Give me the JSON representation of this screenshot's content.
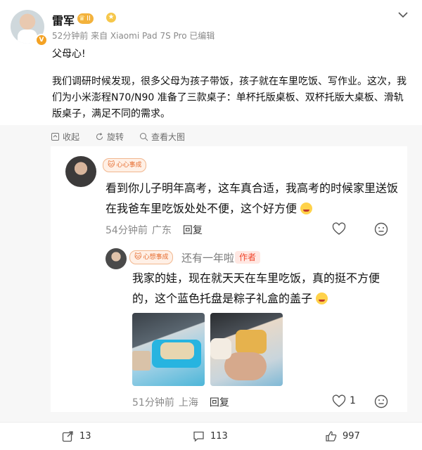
{
  "post": {
    "author": "雷军",
    "level": "II",
    "verify_mark": "V",
    "meta": "52分钟前 来自 Xiaomi Pad 7S Pro 已编辑",
    "text_line1": "父母心!",
    "text_para": "我们调研时候发现，很多父母为孩子带饭，孩子就在车里吃饭、写作业。这次，我们为小米澎程N70/N90 准备了三款桌子：单杯托版桌板、双杯托版大桌板、滑轨版桌子，满足不同的需求。"
  },
  "actions": {
    "collect": "收起",
    "rotate": "旋转",
    "view_large": "查看大图"
  },
  "comment": {
    "fan_tag": "心心事成",
    "text": "看到你儿子明年高考，这车真合适，我高考的时候家里送饭在我爸车里吃饭处处不便，这个好方便",
    "time": "54分钟前",
    "location": "广东",
    "reply_label": "回复"
  },
  "reply": {
    "fan_tag": "心想事成",
    "name": "还有一年啦",
    "author_tag": "作者",
    "text": "我家的娃，现在就天天在车里吃饭，真的挺不方便的，这个蓝色托盘是粽子礼盒的盖子",
    "time": "51分钟前",
    "location": "上海",
    "reply_label": "回复",
    "likes": "1"
  },
  "bottom": {
    "shares": "13",
    "comments": "113",
    "likes": "997"
  },
  "icons": [
    "chevron-down-icon",
    "collapse-icon",
    "rotate-icon",
    "view-large-icon",
    "heart-icon",
    "more-emoji-icon",
    "share-icon",
    "comment-icon",
    "like-thumb-icon"
  ],
  "colors": {
    "accent_orange": "#f4a223",
    "author_tag_red": "#f0452b",
    "muted_gray": "#8a8a8a",
    "bg_gray": "#f7f7f7"
  }
}
